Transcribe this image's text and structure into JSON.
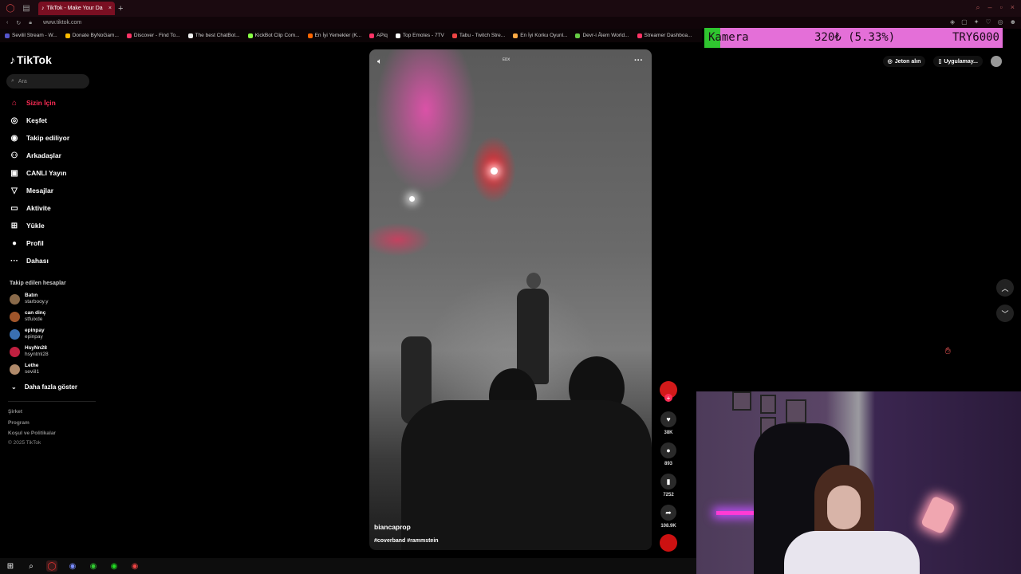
{
  "browser": {
    "tab_title": "TikTok - Make Your Da",
    "url": "www.tiktok.com",
    "bookmarks": [
      {
        "label": "Sevilil Stream - W...",
        "color": "#55c"
      },
      {
        "label": "Donate ByNoGam...",
        "color": "#fb0"
      },
      {
        "label": "Discover - Find To...",
        "color": "#f36"
      },
      {
        "label": "The best ChatBot...",
        "color": "#eee"
      },
      {
        "label": "KickBot Clip Com...",
        "color": "#8f4"
      },
      {
        "label": "En İyi Yemekler (K...",
        "color": "#f60"
      },
      {
        "label": "APiq",
        "color": "#f36"
      },
      {
        "label": "Top Emotes - 7TV",
        "color": "#fff"
      },
      {
        "label": "Tabu - Twitch Stre...",
        "color": "#e44"
      },
      {
        "label": "En İyi Korku Oyunl...",
        "color": "#fa4"
      },
      {
        "label": "Devr-i Âlem World...",
        "color": "#6c4"
      },
      {
        "label": "Streamer Dashboa...",
        "color": "#f36"
      }
    ]
  },
  "stock_overlay": {
    "label": "Kamera",
    "price": "320₺ (5.33%)",
    "total": "TRY6000",
    "colors": {
      "bg": "#e46fd8",
      "accent": "#2fc52f"
    }
  },
  "sidebar": {
    "logo": "TikTok",
    "search_placeholder": "Ara",
    "items": [
      {
        "label": "Sizin İçin",
        "icon": "home-icon",
        "active": true
      },
      {
        "label": "Keşfet",
        "icon": "compass-icon"
      },
      {
        "label": "Takip ediliyor",
        "icon": "following-icon"
      },
      {
        "label": "Arkadaşlar",
        "icon": "friends-icon"
      },
      {
        "label": "CANLI Yayın",
        "icon": "live-icon"
      },
      {
        "label": "Mesajlar",
        "icon": "messages-icon"
      },
      {
        "label": "Aktivite",
        "icon": "activity-icon"
      },
      {
        "label": "Yükle",
        "icon": "upload-icon"
      },
      {
        "label": "Profil",
        "icon": "profile-icon"
      },
      {
        "label": "Dahası",
        "icon": "more-icon"
      }
    ],
    "following_title": "Takip edilen hesaplar",
    "following": [
      {
        "name": "Batın",
        "handle": "starbooy.y"
      },
      {
        "name": "can dinç",
        "handle": "stfuixde"
      },
      {
        "name": "epinpay",
        "handle": "epinpay"
      },
      {
        "name": "HsyNn28",
        "handle": "hsyntml28"
      },
      {
        "name": "Lethe",
        "handle": "seviil1"
      }
    ],
    "show_more": "Daha fazla göster",
    "footer": [
      "Şirket",
      "Program",
      "Koşul ve Politikalar",
      "© 2025 TikTok"
    ]
  },
  "video": {
    "username": "biancaprop",
    "hashtags": "#coverband #rammstein",
    "top_label": "ᴇᴅx",
    "likes": "38K",
    "comments": "893",
    "saves": "7252",
    "shares": "108.9K"
  },
  "top_right": {
    "coins": "Jeton alın",
    "app": "Uygulamay..."
  },
  "brand_color": "#fe2c55"
}
